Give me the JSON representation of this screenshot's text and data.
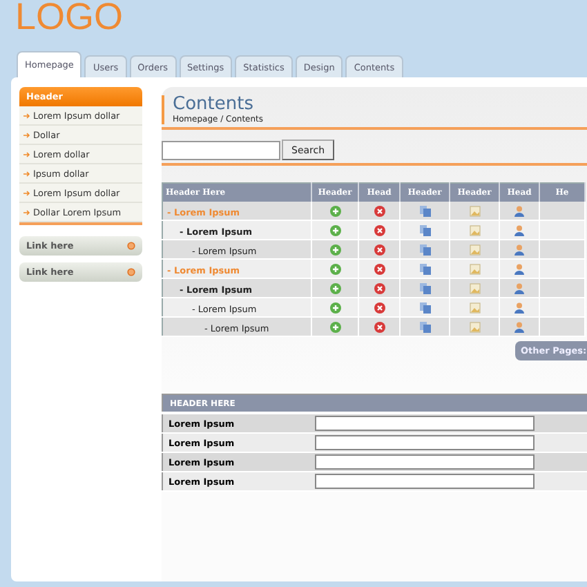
{
  "logo": "LOGO",
  "tabs": [
    {
      "label": "Homepage",
      "selected": true
    },
    {
      "label": "Users",
      "selected": false
    },
    {
      "label": "Orders",
      "selected": false
    },
    {
      "label": "Settings",
      "selected": false
    },
    {
      "label": "Statistics",
      "selected": false
    },
    {
      "label": "Design",
      "selected": false
    },
    {
      "label": "Contents",
      "selected": false
    }
  ],
  "sidebar": {
    "header": "Header",
    "items": [
      "Lorem Ipsum dollar",
      "Dollar",
      "Lorem dollar",
      "Ipsum dollar",
      "Lorem Ipsum dollar",
      "Dollar Lorem Ipsum"
    ],
    "links": [
      "Link here",
      "Link here"
    ]
  },
  "content": {
    "title": "Contents",
    "breadcrumb": "Homepage / Contents",
    "search_button": "Search",
    "table": {
      "columns": [
        "Header Here",
        "Header",
        "Head",
        "Header",
        "Header",
        "Head",
        "He"
      ],
      "rows": [
        {
          "label": "- Lorem Ipsum",
          "children": [
            {
              "label": "- Lorem Ipsum",
              "children": [
                {
                  "label": "- Lorem Ipsum"
                }
              ]
            }
          ]
        },
        {
          "label": "- Lorem Ipsum",
          "children": [
            {
              "label": "- Lorem Ipsum",
              "children": [
                {
                  "label": "- Lorem Ipsum",
                  "children": [
                    {
                      "label": "- Lorem Ipsum"
                    }
                  ]
                }
              ]
            }
          ]
        }
      ]
    },
    "other_pages": "Other Pages:",
    "form": {
      "header": "HEADER HERE",
      "fields": [
        "Lorem Ipsum",
        "Lorem Ipsum",
        "Lorem Ipsum",
        "Lorem Ipsum"
      ]
    }
  }
}
